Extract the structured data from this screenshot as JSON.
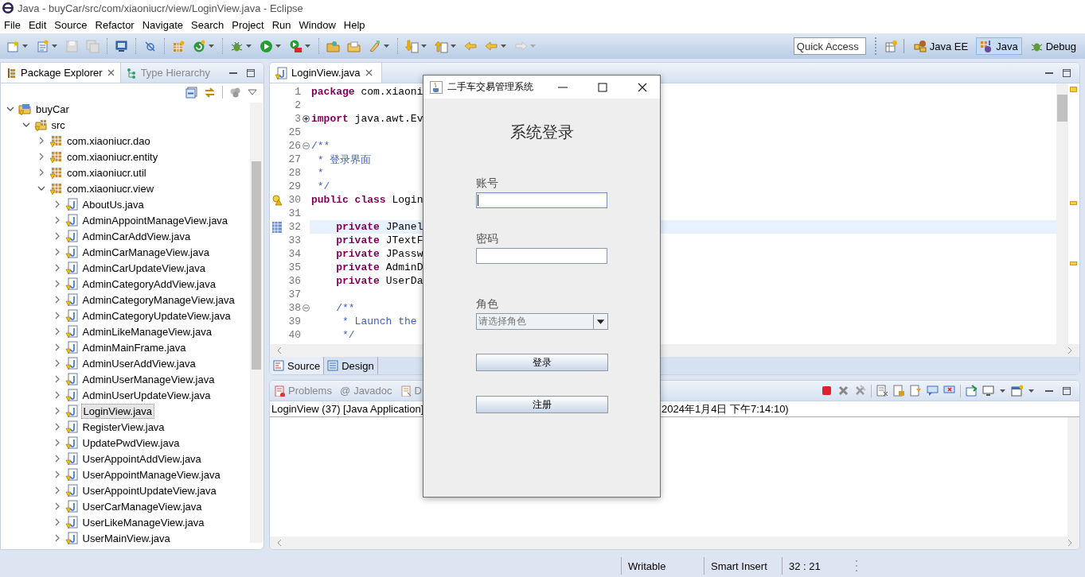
{
  "window": {
    "title": "Java - buyCar/src/com/xiaoniucr/view/LoginView.java - Eclipse"
  },
  "menu": [
    "File",
    "Edit",
    "Source",
    "Refactor",
    "Navigate",
    "Search",
    "Project",
    "Run",
    "Window",
    "Help"
  ],
  "quick_access": {
    "placeholder": "Quick Access"
  },
  "perspectives": [
    {
      "label": "Java EE",
      "selected": false
    },
    {
      "label": "Java",
      "selected": true
    },
    {
      "label": "Debug",
      "selected": false
    }
  ],
  "package_explorer": {
    "tabs": [
      {
        "label": "Package Explorer",
        "selected": true
      },
      {
        "label": "Type Hierarchy",
        "selected": false
      }
    ],
    "tree": [
      {
        "label": "buyCar",
        "kind": "project",
        "expanded": true,
        "selected": false,
        "children": [
          {
            "label": "src",
            "kind": "source",
            "expanded": true,
            "selected": false,
            "children": [
              {
                "label": "com.xiaoniucr.dao",
                "kind": "package",
                "expanded": false,
                "selected": false
              },
              {
                "label": "com.xiaoniucr.entity",
                "kind": "package",
                "expanded": false,
                "selected": false
              },
              {
                "label": "com.xiaoniucr.util",
                "kind": "package",
                "expanded": false,
                "selected": false
              },
              {
                "label": "com.xiaoniucr.view",
                "kind": "package",
                "expanded": true,
                "selected": false,
                "children": [
                  {
                    "label": "AboutUs.java",
                    "kind": "file",
                    "expanded": false,
                    "selected": false
                  },
                  {
                    "label": "AdminAppointManageView.java",
                    "kind": "file",
                    "expanded": false,
                    "selected": false
                  },
                  {
                    "label": "AdminCarAddView.java",
                    "kind": "file",
                    "expanded": false,
                    "selected": false
                  },
                  {
                    "label": "AdminCarManageView.java",
                    "kind": "file",
                    "expanded": false,
                    "selected": false
                  },
                  {
                    "label": "AdminCarUpdateView.java",
                    "kind": "file",
                    "expanded": false,
                    "selected": false
                  },
                  {
                    "label": "AdminCategoryAddView.java",
                    "kind": "file",
                    "expanded": false,
                    "selected": false
                  },
                  {
                    "label": "AdminCategoryManageView.java",
                    "kind": "file",
                    "expanded": false,
                    "selected": false
                  },
                  {
                    "label": "AdminCategoryUpdateView.java",
                    "kind": "file",
                    "expanded": false,
                    "selected": false
                  },
                  {
                    "label": "AdminLikeManageView.java",
                    "kind": "file",
                    "expanded": false,
                    "selected": false
                  },
                  {
                    "label": "AdminMainFrame.java",
                    "kind": "file",
                    "expanded": false,
                    "selected": false
                  },
                  {
                    "label": "AdminUserAddView.java",
                    "kind": "file",
                    "expanded": false,
                    "selected": false
                  },
                  {
                    "label": "AdminUserManageView.java",
                    "kind": "file",
                    "expanded": false,
                    "selected": false
                  },
                  {
                    "label": "AdminUserUpdateView.java",
                    "kind": "file",
                    "expanded": false,
                    "selected": false
                  },
                  {
                    "label": "LoginView.java",
                    "kind": "file",
                    "expanded": false,
                    "selected": true
                  },
                  {
                    "label": "RegisterView.java",
                    "kind": "file",
                    "expanded": false,
                    "selected": false
                  },
                  {
                    "label": "UpdatePwdView.java",
                    "kind": "file",
                    "expanded": false,
                    "selected": false
                  },
                  {
                    "label": "UserAppointAddView.java",
                    "kind": "file",
                    "expanded": false,
                    "selected": false
                  },
                  {
                    "label": "UserAppointManageView.java",
                    "kind": "file",
                    "expanded": false,
                    "selected": false
                  },
                  {
                    "label": "UserAppointUpdateView.java",
                    "kind": "file",
                    "expanded": false,
                    "selected": false
                  },
                  {
                    "label": "UserCarManageView.java",
                    "kind": "file",
                    "expanded": false,
                    "selected": false
                  },
                  {
                    "label": "UserLikeManageView.java",
                    "kind": "file",
                    "expanded": false,
                    "selected": false
                  },
                  {
                    "label": "UserMainView.java",
                    "kind": "file",
                    "expanded": false,
                    "selected": false
                  }
                ]
              }
            ]
          }
        ]
      }
    ]
  },
  "editor": {
    "tabs": [
      {
        "label": "LoginView.java",
        "selected": true
      }
    ],
    "lines": [
      {
        "number": "1",
        "current": false,
        "parts": [
          {
            "text": "package",
            "kind": "keyword"
          },
          {
            "text": " com.xiaoni",
            "kind": "plain"
          }
        ]
      },
      {
        "number": "2",
        "current": false
      },
      {
        "number": "3",
        "current": false,
        "collapsed": true,
        "parts": [
          {
            "text": "import",
            "kind": "keyword"
          },
          {
            "text": " java.awt.Ev",
            "kind": "plain"
          }
        ]
      },
      {
        "number": "25",
        "current": false
      },
      {
        "number": "26",
        "current": false,
        "collapsed": false,
        "parts": [
          {
            "text": "/**",
            "kind": "comment"
          }
        ]
      },
      {
        "number": "27",
        "current": false,
        "parts": [
          {
            "text": " * 登录界面",
            "kind": "comment"
          }
        ]
      },
      {
        "number": "28",
        "current": false,
        "parts": [
          {
            "text": " *",
            "kind": "comment"
          }
        ]
      },
      {
        "number": "29",
        "current": false,
        "parts": [
          {
            "text": " */",
            "kind": "comment"
          }
        ]
      },
      {
        "number": "30",
        "current": false,
        "warning": true,
        "parts": [
          {
            "text": "public class",
            "kind": "keyword"
          },
          {
            "text": " Login",
            "kind": "plain"
          }
        ]
      },
      {
        "number": "31",
        "current": false
      },
      {
        "number": "32",
        "current": true,
        "parts": [
          {
            "text": "    private",
            "kind": "keyword"
          },
          {
            "text": " JPanel",
            "kind": "plain"
          }
        ]
      },
      {
        "number": "33",
        "current": false,
        "parts": [
          {
            "text": "    private",
            "kind": "keyword"
          },
          {
            "text": " JTextF",
            "kind": "plain"
          }
        ]
      },
      {
        "number": "34",
        "current": false,
        "parts": [
          {
            "text": "    private",
            "kind": "keyword"
          },
          {
            "text": " JPassw",
            "kind": "plain"
          }
        ]
      },
      {
        "number": "35",
        "current": false,
        "parts": [
          {
            "text": "    private",
            "kind": "keyword"
          },
          {
            "text": " AdminD",
            "kind": "plain"
          }
        ]
      },
      {
        "number": "36",
        "current": false,
        "parts": [
          {
            "text": "    private",
            "kind": "keyword"
          },
          {
            "text": " UserDa",
            "kind": "plain"
          }
        ]
      },
      {
        "number": "37",
        "current": false
      },
      {
        "number": "38",
        "current": false,
        "collapsed": false,
        "parts": [
          {
            "text": "    /**",
            "kind": "comment"
          }
        ]
      },
      {
        "number": "39",
        "current": false,
        "parts": [
          {
            "text": "     * Launch the",
            "kind": "comment"
          }
        ]
      },
      {
        "number": "40",
        "current": false,
        "parts": [
          {
            "text": "     */",
            "kind": "comment"
          }
        ]
      }
    ],
    "bottom_tabs": [
      {
        "label": "Source",
        "selected": true
      },
      {
        "label": "Design",
        "selected": false
      }
    ]
  },
  "console": {
    "tabs": [
      {
        "label": "Problems",
        "kind": "problems"
      },
      {
        "label": "Javadoc",
        "kind": "javadoc",
        "glyph": "@"
      },
      {
        "label": "D",
        "kind": "declaration"
      }
    ],
    "launch": "LoginView (37) [Java Application]",
    "launch_time": "2024年1月4日 下午7:14:10)"
  },
  "login_dialog": {
    "title": "二手车交易管理系统",
    "heading": "系统登录",
    "fields": [
      {
        "label": "账号",
        "kind": "text",
        "focused": true
      },
      {
        "label": "密码",
        "kind": "password",
        "focused": false
      },
      {
        "label": "角色",
        "kind": "select",
        "value": "请选择角色"
      }
    ],
    "buttons": [
      "登录",
      "注册"
    ]
  },
  "status_bar": {
    "mode": "Writable",
    "insert_mode": "Smart Insert",
    "position": "32 : 21"
  }
}
